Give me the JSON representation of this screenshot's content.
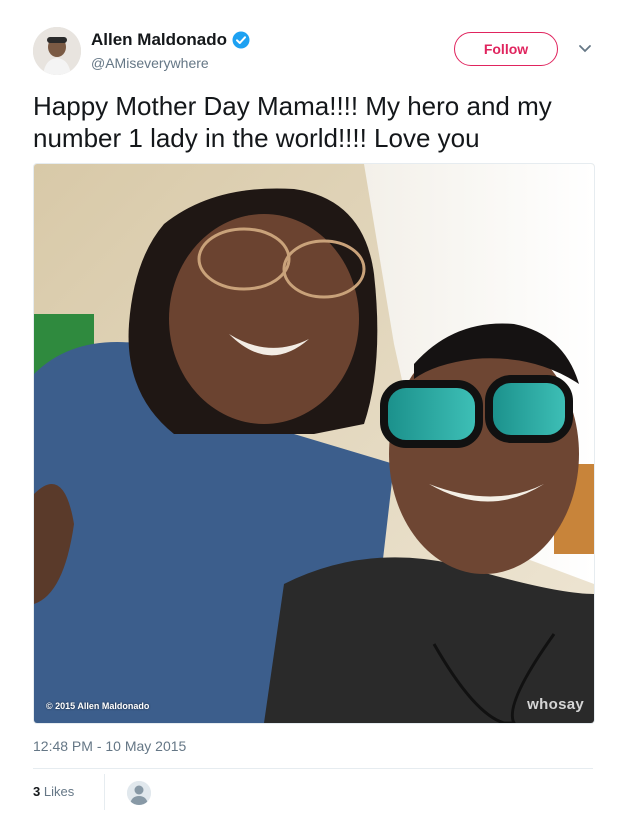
{
  "tweet": {
    "author_name": "Allen Maldonado",
    "author_handle": "@AMiseverywhere",
    "follow_label": "Follow",
    "text": "Happy Mother Day Mama!!!! My hero and my number 1 lady in the world!!!! Love you",
    "photo_copyright": "© 2015 Allen Maldonado",
    "photo_watermark": "whosay",
    "timestamp": "12:48 PM - 10 May 2015",
    "likes_count": "3",
    "likes_label": "Likes"
  },
  "icons": {
    "verified": "verified-badge-icon",
    "caret": "chevron-down-icon",
    "avatar_placeholder": "default-avatar-icon"
  },
  "colors": {
    "follow_accent": "#e0245e",
    "verified_blue": "#1da1f2",
    "secondary_text": "#657786"
  }
}
